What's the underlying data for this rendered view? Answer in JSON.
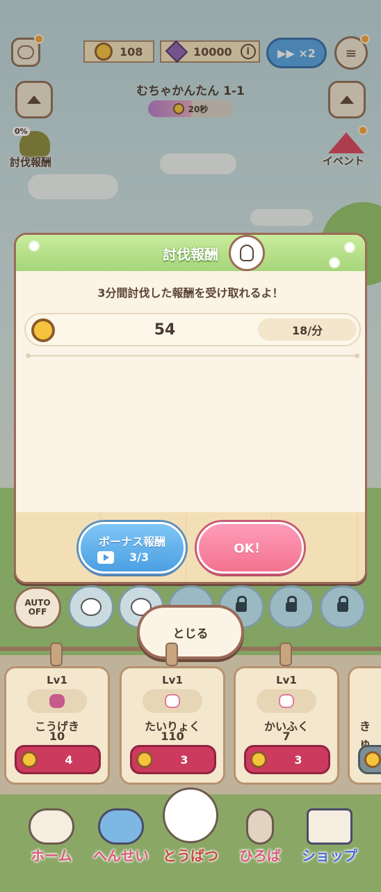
{
  "hud": {
    "coins": "108",
    "gems": "10000",
    "info_glyph": "i",
    "speed_label": "▶▶ ×2",
    "menu_glyph": "≡",
    "stage_title": "むちゃかんたん 1-1",
    "timer_text": "20秒",
    "reward_percent": "0%",
    "left_label": "討伐報酬",
    "right_label": "イベント"
  },
  "modal": {
    "title": "討伐報酬",
    "subtitle": "3分間討伐した報酬を受け取れるよ！",
    "reward_amount": "54",
    "reward_rate": "18/分",
    "bonus_label": "ボーナス報酬",
    "bonus_count": "3/3",
    "ok_label": "OK！"
  },
  "controls": {
    "auto_line1": "AUTO",
    "auto_line2": "OFF",
    "close_label": "とじる"
  },
  "cards": [
    {
      "level": "Lv1",
      "name": "こうげき",
      "value": "10",
      "cost": "4",
      "icon": "attack-icon",
      "color": "#c65a8a"
    },
    {
      "level": "Lv1",
      "name": "たいりょく",
      "value": "110",
      "cost": "3",
      "icon": "heart-icon",
      "color": "#e07a98"
    },
    {
      "level": "Lv1",
      "name": "かいふく",
      "value": "7",
      "cost": "3",
      "icon": "heal-icon",
      "color": "#e07a98"
    },
    {
      "level": "",
      "name": "きゅ",
      "value": "",
      "cost": "",
      "icon": "partial-card-icon",
      "color": "#888888"
    }
  ],
  "nav": [
    {
      "label": "ホーム",
      "icon": "home-icon"
    },
    {
      "label": "へんせい",
      "icon": "team-icon"
    },
    {
      "label": "とうばつ",
      "icon": "battle-icon"
    },
    {
      "label": "ひろば",
      "icon": "signpost-icon"
    },
    {
      "label": "ショップ",
      "icon": "shop-icon"
    }
  ],
  "colors": {
    "modal_border": "#9b6a58",
    "header_green": "#a6d57a",
    "bonus_blue": "#4b9fe3",
    "ok_pink": "#f2728f",
    "buy_red": "#cc3a5e"
  }
}
